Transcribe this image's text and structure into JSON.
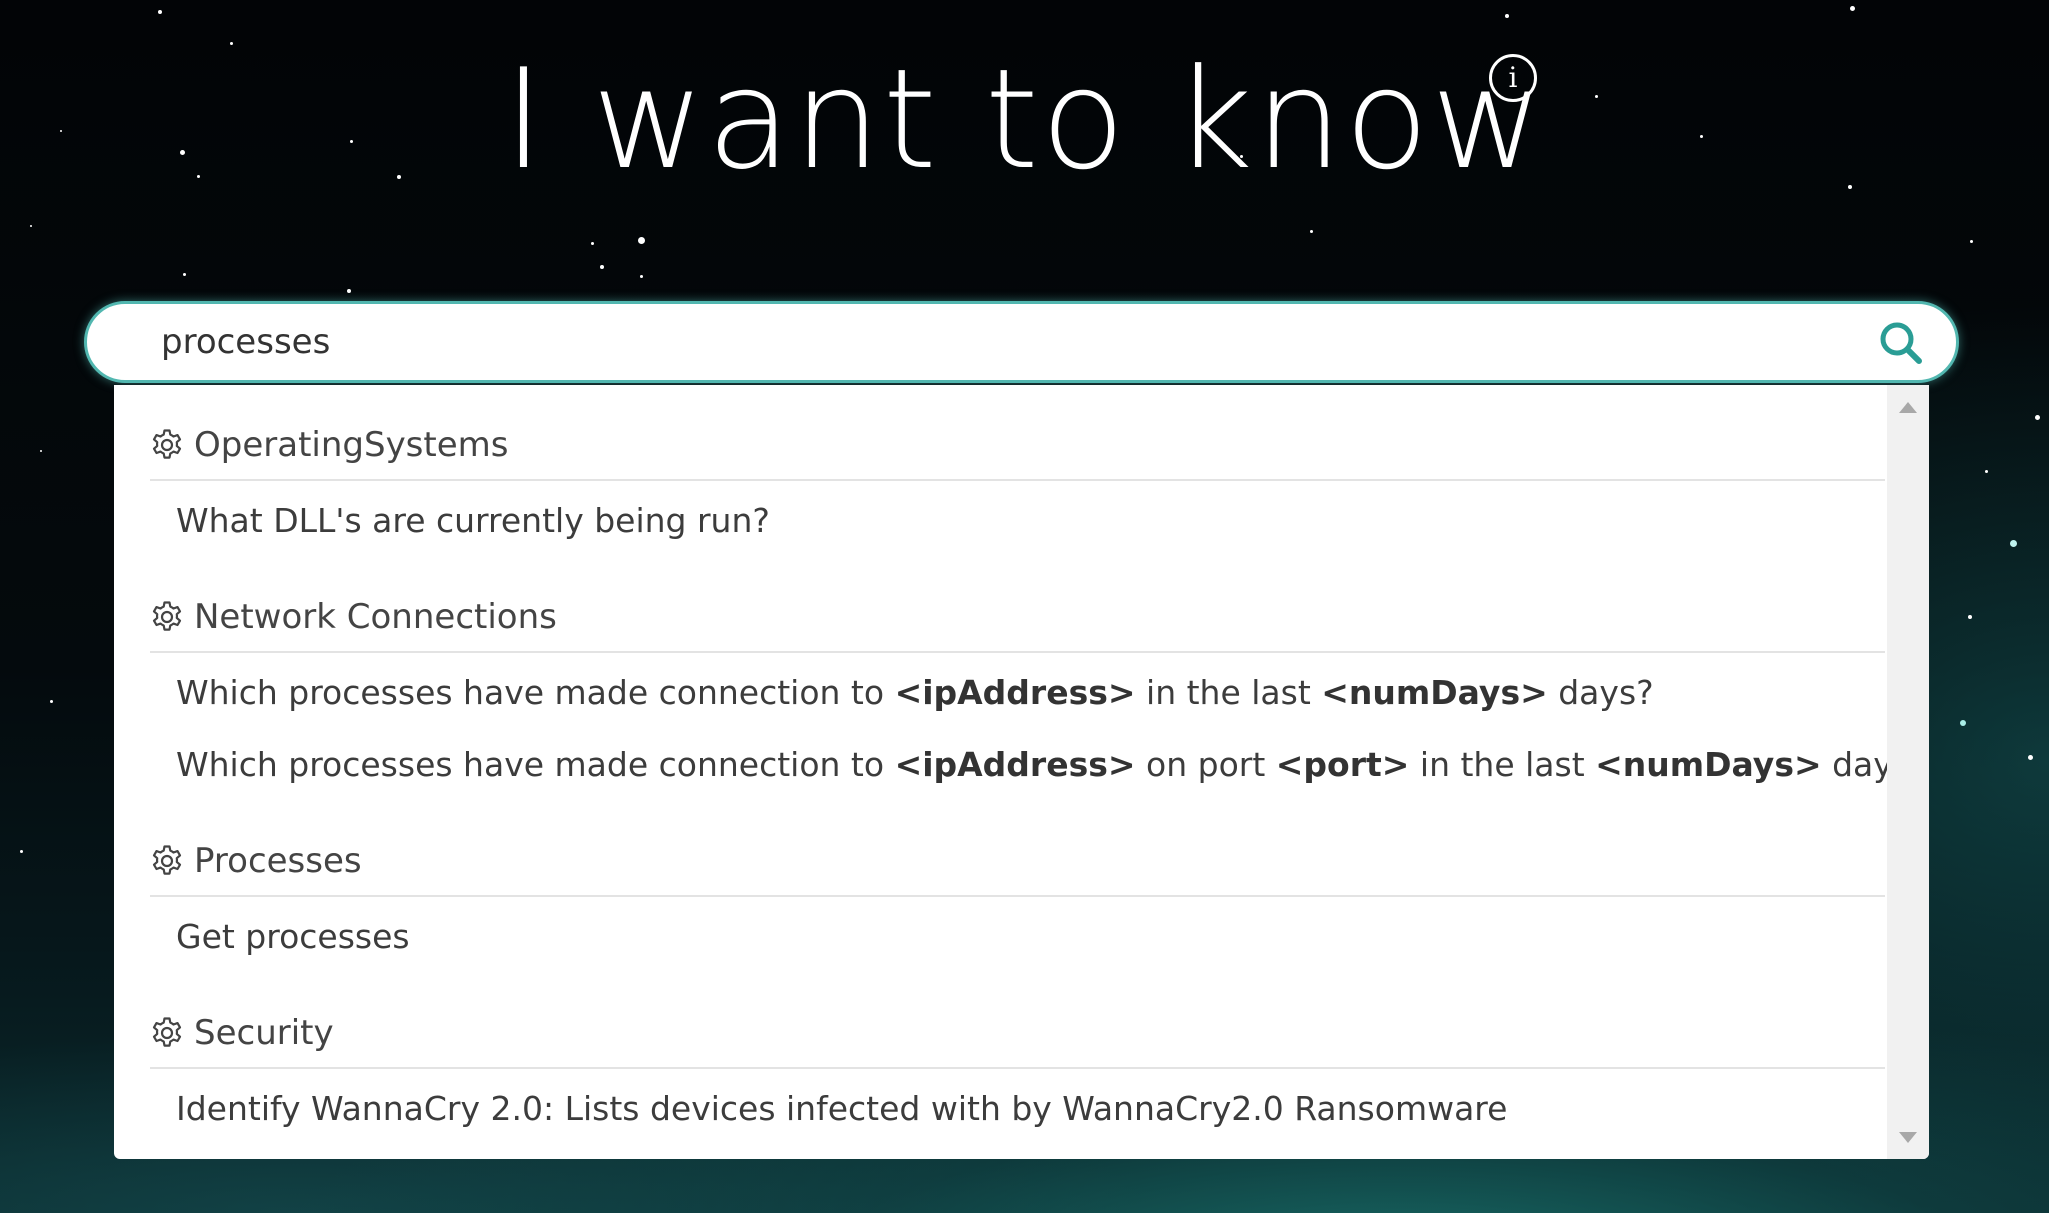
{
  "header": {
    "title": "I want to know"
  },
  "search": {
    "value": "processes"
  },
  "dropdown": {
    "groups": [
      {
        "category": "OperatingSystems",
        "items": [
          {
            "parts": [
              "What DLL's are currently being run?"
            ]
          }
        ]
      },
      {
        "category": "Network Connections",
        "items": [
          {
            "parts": [
              "Which processes have made connection to ",
              "<ipAddress>",
              " in the last ",
              "<numDays>",
              " days?"
            ]
          },
          {
            "parts": [
              "Which processes have made connection to ",
              "<ipAddress>",
              " on port ",
              "<port>",
              " in the last ",
              "<numDays>",
              " days?"
            ]
          }
        ]
      },
      {
        "category": "Processes",
        "items": [
          {
            "parts": [
              "Get processes"
            ]
          }
        ]
      },
      {
        "category": "Security",
        "items": [
          {
            "parts": [
              "Identify WannaCry 2.0: Lists devices infected with by WannaCry2.0 Ransomware"
            ]
          }
        ]
      }
    ]
  },
  "icons": {
    "info": "info-icon",
    "search": "search-icon",
    "category": "gear-icon"
  },
  "colors": {
    "accent": "#52b7b0",
    "search_icon": "#2a9d95"
  }
}
